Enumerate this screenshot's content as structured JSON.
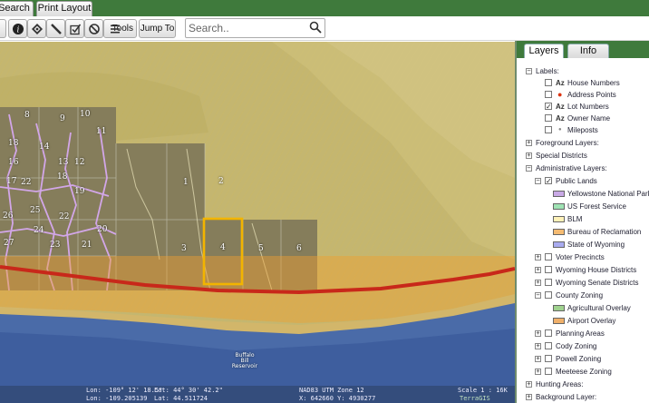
{
  "top_tabs": [
    "Search",
    "Print Layout"
  ],
  "toolbar": {
    "tools_label": "Tools",
    "jump_label": "Jump To",
    "search_placeholder": "Search.."
  },
  "panel_tabs": [
    "Layers",
    "Info"
  ],
  "labels": {
    "group": "Labels:",
    "items": [
      {
        "label": "House Numbers",
        "checked": false,
        "icon": "az-icon"
      },
      {
        "label": "Address Points",
        "checked": false,
        "icon": "red-dot-icon"
      },
      {
        "label": "Lot Numbers",
        "checked": true,
        "icon": "az-icon"
      },
      {
        "label": "Owner Name",
        "checked": false,
        "icon": "az-icon"
      },
      {
        "label": "Mileposts",
        "checked": false,
        "icon": "dot-icon"
      }
    ]
  },
  "groups": {
    "foreground": "Foreground Layers:",
    "special": "Special Districts",
    "administrative": "Administrative Layers:",
    "hunting": "Hunting Areas:",
    "background": "Background Layer:"
  },
  "public_lands": {
    "label": "Public Lands",
    "checked": true,
    "legend": [
      {
        "label": "Yellowstone National Park",
        "color": "#c9a9e6"
      },
      {
        "label": "US Forest Service",
        "color": "#9fe3b4"
      },
      {
        "label": "BLM",
        "color": "#fff2b8"
      },
      {
        "label": "Bureau of Reclamation",
        "color": "#f5bb72"
      },
      {
        "label": "State of Wyoming",
        "color": "#a9abf0"
      }
    ]
  },
  "admin_layers": [
    "Voter Precincts",
    "Wyoming House Districts",
    "Wyoming Senate Districts",
    "County Zoning"
  ],
  "county_zoning_legend": [
    {
      "label": "Agricultural Overlay",
      "color": "#9fd28e"
    },
    {
      "label": "Airport Overlay",
      "color": "#f0b06a"
    }
  ],
  "admin_layers_after": [
    "Planning Areas",
    "Cody Zoning",
    "Powell Zoning",
    "Meeteese Zoning"
  ],
  "map": {
    "lots": [
      "8",
      "9",
      "10",
      "11",
      "18",
      "14",
      "16",
      "13",
      "12",
      "17",
      "18",
      "19",
      "22",
      "25",
      "26",
      "22",
      "24",
      "23",
      "21",
      "27",
      "20",
      "1",
      "2",
      "3",
      "4",
      "5",
      "6"
    ],
    "water_label": [
      "Buffalo",
      "Bill",
      "Reservoir"
    ],
    "status": {
      "lon1": "Lon: -109° 12' 18.5\"",
      "lat1": "Lat: 44° 30' 42.2\"",
      "lon2": "Lon: -109.205139",
      "lat2": "Lat: 44.511724",
      "utm": "NAD83 UTM Zone 12",
      "xy": "X: 642660 Y: 4930277",
      "scale": "Scale 1 : 16K",
      "brand": "TerraGIS"
    }
  },
  "colors": {
    "brand_green": "#3f7a3c",
    "highway": "#c8281a",
    "selected_lot": "#f2b400"
  }
}
